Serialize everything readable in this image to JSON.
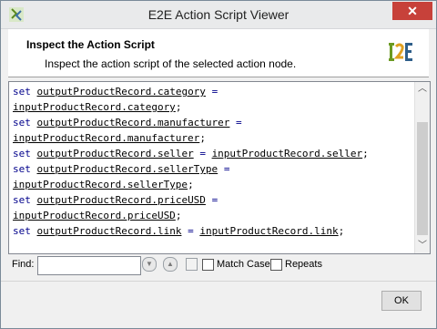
{
  "window": {
    "title": "E2E Action Script Viewer",
    "close_glyph": "✕"
  },
  "header": {
    "title": "Inspect the Action Script",
    "description": "Inspect the action script of the selected action node."
  },
  "code_lines": [
    [
      "set",
      "outputProductRecord.category",
      "=",
      ""
    ],
    [
      "",
      "inputProductRecord.category",
      ";",
      ""
    ],
    [
      "set",
      "outputProductRecord.manufacturer",
      "=",
      ""
    ],
    [
      "",
      "inputProductRecord.manufacturer",
      ";",
      ""
    ],
    [
      "set",
      "outputProductRecord.seller",
      "=",
      "inputProductRecord.seller",
      ";"
    ],
    [
      "set",
      "outputProductRecord.sellerType",
      "=",
      ""
    ],
    [
      "",
      "inputProductRecord.sellerType",
      ";",
      ""
    ],
    [
      "set",
      "outputProductRecord.priceUSD",
      "=",
      ""
    ],
    [
      "",
      "inputProductRecord.priceUSD",
      ";",
      ""
    ],
    [
      "set",
      "outputProductRecord.link",
      "=",
      "inputProductRecord.link",
      ";"
    ]
  ],
  "find": {
    "label": "Find:",
    "value": "",
    "match_case_label": "Match Case",
    "repeats_label": "Repeats"
  },
  "footer": {
    "ok_label": "OK"
  },
  "icons": {
    "app": "e2e-app-icon",
    "logo": "e2e-logo",
    "close": "close-icon",
    "find_next": "find-down-icon",
    "find_prev": "find-up-icon",
    "find_list": "find-list-icon",
    "scroll_up": "scroll-up-icon",
    "scroll_down": "scroll-down-icon"
  },
  "colors": {
    "close_button": "#c7413a",
    "keyword": "#00008b"
  }
}
